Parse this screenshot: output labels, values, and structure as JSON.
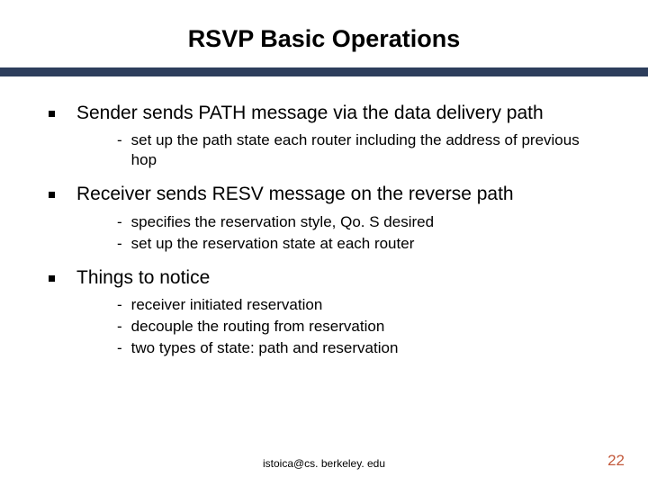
{
  "title": "RSVP Basic Operations",
  "bullets": [
    {
      "text": "Sender sends PATH message via the data delivery path",
      "subs": [
        "set up the path state each router including the address of previous hop"
      ]
    },
    {
      "text": "Receiver sends RESV message on the reverse path",
      "subs": [
        "specifies the reservation style, Qo. S desired",
        "set up the reservation state at each router"
      ]
    },
    {
      "text": "Things to notice",
      "subs": [
        "receiver initiated reservation",
        "decouple the routing from reservation",
        "two types of state: path and reservation"
      ]
    }
  ],
  "footer": {
    "email": "istoica@cs. berkeley. edu",
    "page": "22"
  }
}
